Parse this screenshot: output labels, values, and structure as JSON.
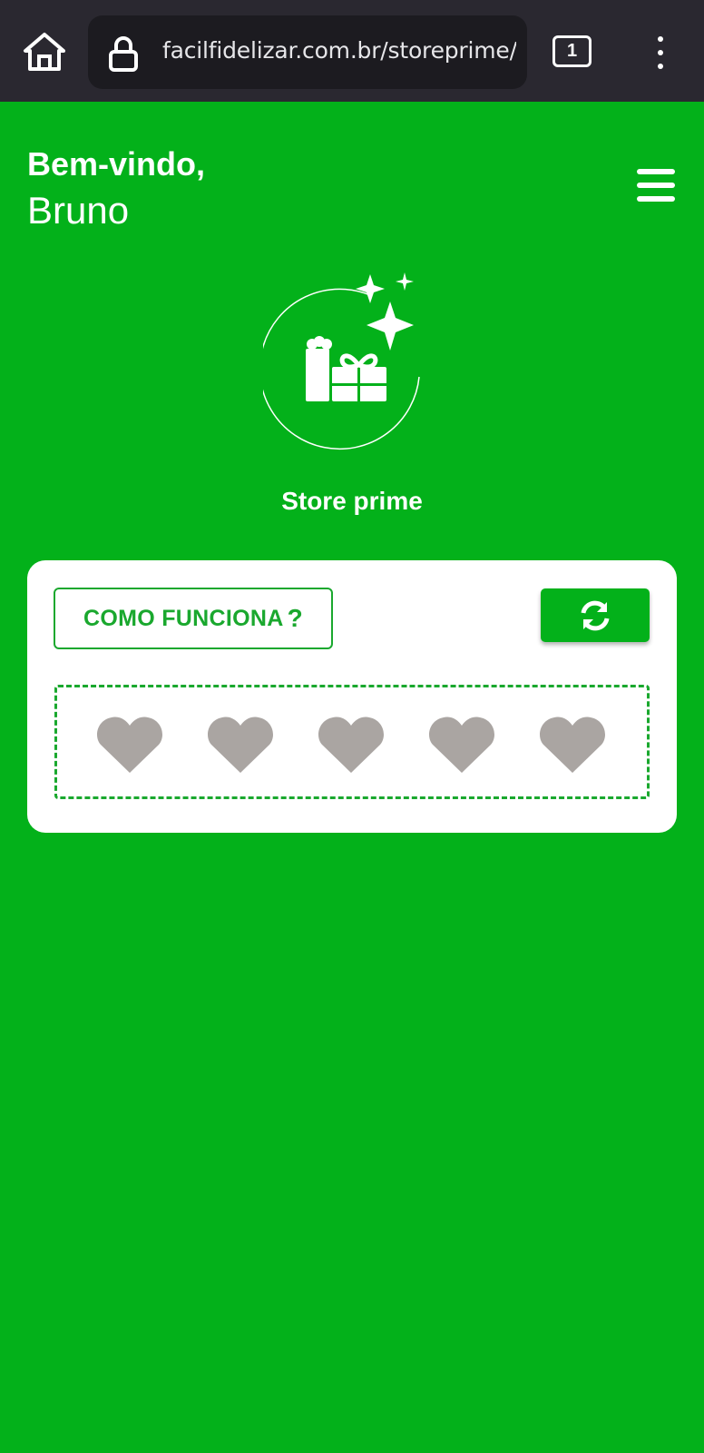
{
  "browser": {
    "url": "facilfidelizar.com.br/storeprime/m",
    "tab_count": "1"
  },
  "greeting": {
    "line1": "Bem-vindo,",
    "name": "Bruno"
  },
  "store": {
    "title": "Store prime"
  },
  "card": {
    "how_label": "COMO FUNCIONA",
    "how_suffix": "?",
    "hearts_total": 5,
    "hearts_filled": 0
  },
  "colors": {
    "brand_green": "#03b11a",
    "heart_empty": "#aaa5a2"
  },
  "icons": [
    "home-icon",
    "lock-icon",
    "menu-icon",
    "gift-icon",
    "sparkle-icon",
    "refresh-icon",
    "heart-icon"
  ]
}
